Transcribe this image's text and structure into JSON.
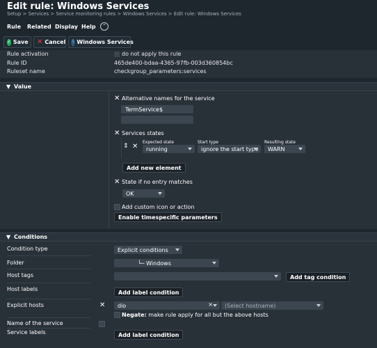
{
  "header": {
    "title": "Edit rule: Windows Services",
    "breadcrumb": "Setup > Services > Service monitoring rules > Windows Services > Edit rule: Windows Services"
  },
  "menu": {
    "items": [
      "Rule",
      "Related",
      "Display",
      "Help"
    ]
  },
  "toolbar": {
    "save_label": "Save",
    "cancel_label": "Cancel",
    "services_label": "Windows Services"
  },
  "rule_props": {
    "activation_label": "Rule activation",
    "activation_value": "do not apply this rule",
    "id_label": "Rule ID",
    "id_value": "465de400-bdaa-4365-97fb-003d360854bc",
    "ruleset_label": "Ruleset name",
    "ruleset_value": "checkgroup_parameters:services"
  },
  "value_section": {
    "header": "Value",
    "alt_names_label": "Alternative names for the service",
    "alt_name_value": "TermService$",
    "alt_name_empty": "",
    "services_states_label": "Services states",
    "col_expected": "Expected state",
    "col_start": "Start type",
    "col_result": "Resulting state",
    "expected_value": "running",
    "start_value": "ignore the start type",
    "result_value": "WARN",
    "add_element_label": "Add new element",
    "no_match_label": "State if no entry matches",
    "no_match_value": "OK",
    "custom_icon_label": "Add custom icon or action",
    "timespecific_label": "Enable timespecific parameters"
  },
  "conditions": {
    "header": "Conditions",
    "condition_type_label": "Condition type",
    "condition_type_value": "Explicit conditions",
    "folder_label": "Folder",
    "folder_value": "└─ Windows",
    "host_tags_label": "Host tags",
    "host_tags_value": "",
    "add_tag_condition": "Add tag condition",
    "host_labels_label": "Host labels",
    "add_label_condition": "Add label condition",
    "explicit_hosts_label": "Explicit hosts",
    "host_value": "dio",
    "hostname_placeholder": "(Select hostname)",
    "negate_bold": "Negate:",
    "negate_text": "make rule apply for all but the above hosts",
    "service_name_label": "Name of the service",
    "service_labels_label": "Service labels",
    "add_label_condition_2": "Add label condition"
  },
  "colors": {
    "background": "#1e262e",
    "panel": "#283038",
    "input": "#3b4650",
    "save_green": "#1eb457",
    "cancel_red": "#e03a3a",
    "info_blue": "#3d8fd6"
  }
}
